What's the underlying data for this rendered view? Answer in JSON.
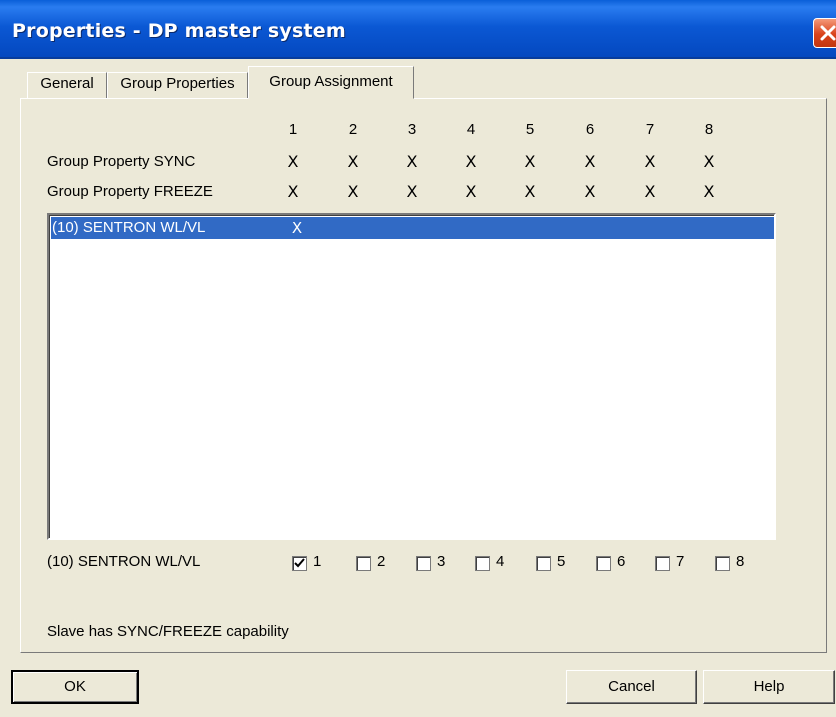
{
  "window": {
    "title": "Properties - DP master system",
    "close_icon": "close-icon"
  },
  "tabs": [
    {
      "label": "General"
    },
    {
      "label": "Group Properties"
    },
    {
      "label": "Group Assignment"
    }
  ],
  "group_table": {
    "columns": [
      "1",
      "2",
      "3",
      "4",
      "5",
      "6",
      "7",
      "8"
    ],
    "rows": [
      {
        "label": "Group Property SYNC",
        "marks": [
          "X",
          "X",
          "X",
          "X",
          "X",
          "X",
          "X",
          "X"
        ]
      },
      {
        "label": "Group Property FREEZE",
        "marks": [
          "X",
          "X",
          "X",
          "X",
          "X",
          "X",
          "X",
          "X"
        ]
      }
    ]
  },
  "slave_list": [
    {
      "name": "(10) SENTRON WL/VL",
      "mark": "X",
      "selected": true
    }
  ],
  "assignment": {
    "slave_label": "(10) SENTRON WL/VL",
    "groups": [
      {
        "label": "1",
        "checked": true
      },
      {
        "label": "2",
        "checked": false
      },
      {
        "label": "3",
        "checked": false
      },
      {
        "label": "4",
        "checked": false
      },
      {
        "label": "5",
        "checked": false
      },
      {
        "label": "6",
        "checked": false
      },
      {
        "label": "7",
        "checked": false
      },
      {
        "label": "8",
        "checked": false
      }
    ]
  },
  "status_text": "Slave has SYNC/FREEZE capability",
  "buttons": {
    "ok": "OK",
    "cancel": "Cancel",
    "help": "Help"
  },
  "colors": {
    "title_bar": "#0a58d6",
    "selection": "#316ac5",
    "dialog_bg": "#ece9d8",
    "close_button": "#d9421b"
  }
}
